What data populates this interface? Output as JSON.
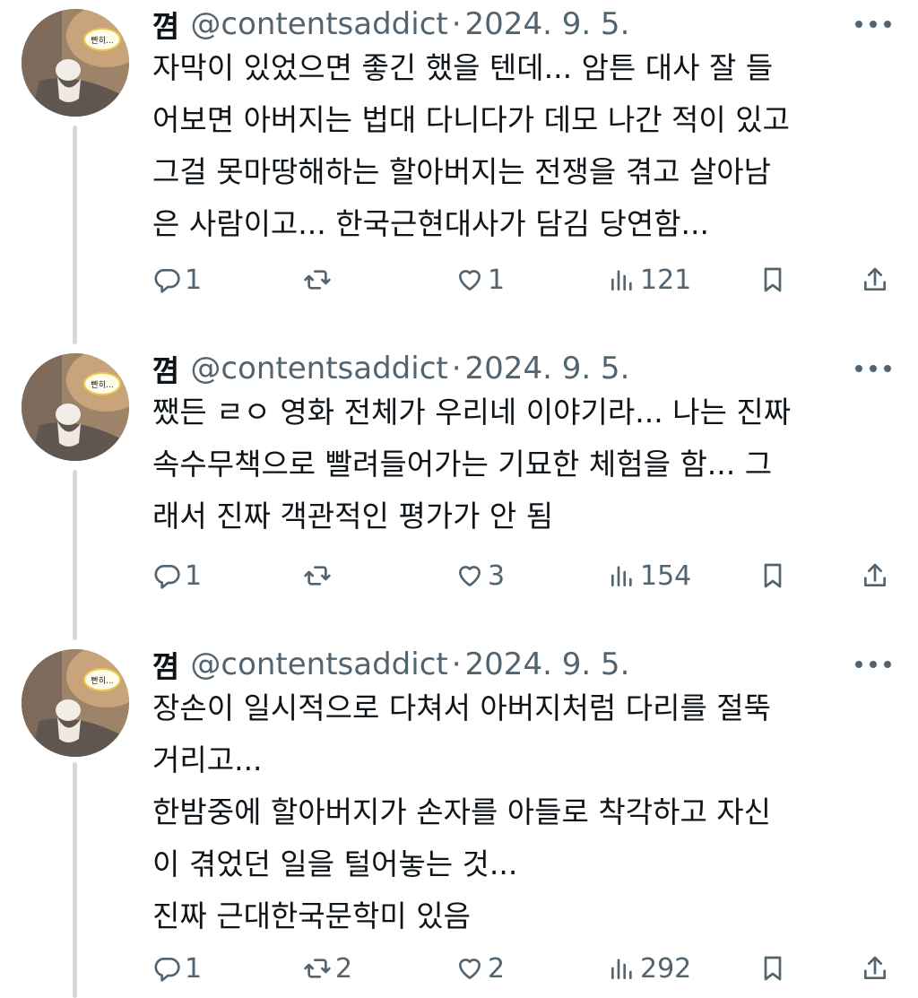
{
  "tweets": [
    {
      "name": "꼄",
      "handle": "@contentsaddict",
      "separator": "·",
      "date": "2024. 9. 5.",
      "text": "자막이 있었으면 좋긴 했을 텐데... 암튼 대사 잘 들\n어보면 아버지는 법대 다니다가 데모 나간 적이 있고\n그걸 못마땅해하는 할아버지는 전쟁을 겪고 살아남\n은 사람이고... 한국근현대사가 담김 당연함...",
      "replies": "1",
      "retweets": "",
      "likes": "1",
      "views": "121"
    },
    {
      "name": "꼄",
      "handle": "@contentsaddict",
      "separator": "·",
      "date": "2024. 9. 5.",
      "text": "쨌든 ㄹㅇ 영화 전체가 우리네 이야기라... 나는 진짜\n속수무책으로 빨려들어가는 기묘한 체험을 함... 그\n래서 진짜 객관적인 평가가 안 됨",
      "replies": "1",
      "retweets": "",
      "likes": "3",
      "views": "154"
    },
    {
      "name": "꼄",
      "handle": "@contentsaddict",
      "separator": "·",
      "date": "2024. 9. 5.",
      "text": "장손이 일시적으로 다쳐서 아버지처럼 다리를 절뚝\n거리고...\n한밤중에 할아버지가 손자를 아들로 착각하고 자신\n이 겪었던 일을 털어놓는 것...\n진짜 근대한국문학미 있음",
      "replies": "1",
      "retweets": "2",
      "likes": "2",
      "views": "292"
    }
  ],
  "avatar_badge": "빤히...",
  "icons": {
    "reply": "reply-icon",
    "retweet": "retweet-icon",
    "like": "heart-icon",
    "views": "views-icon",
    "bookmark": "bookmark-icon",
    "share": "share-icon",
    "more": "more-icon"
  },
  "colors": {
    "text": "#0f1419",
    "secondary": "#536471",
    "thread_line": "#cfd9de"
  }
}
